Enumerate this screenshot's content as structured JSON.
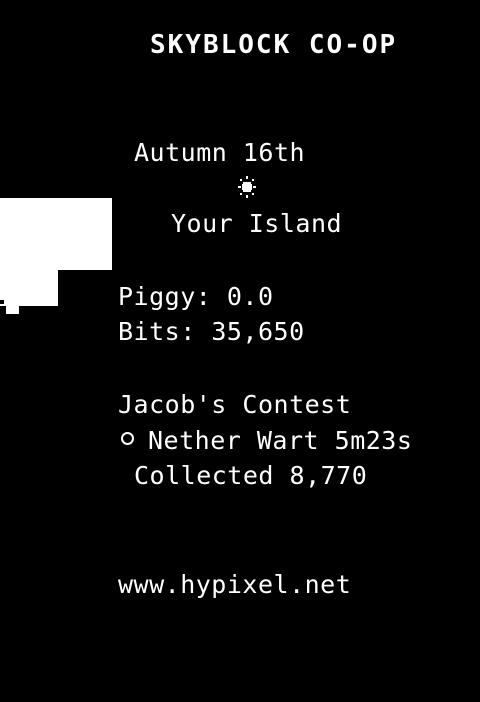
{
  "scoreboard": {
    "title": "SKYBLOCK CO-OP",
    "date": "Autumn 16th",
    "time_icon": "sun-icon",
    "location": "Your Island",
    "piggy_label": "Piggy:",
    "piggy_value": "0.0",
    "bits_label": "Bits:",
    "bits_value": "35,650",
    "contest_title": "Jacob's Contest",
    "contest_crop": "Nether Wart",
    "contest_time": "5m23s",
    "contest_collected_label": "Collected",
    "contest_collected_value": "8,770",
    "server": "www.hypixel.net"
  },
  "colors": {
    "background": "#000000",
    "text": "#ffffff"
  }
}
